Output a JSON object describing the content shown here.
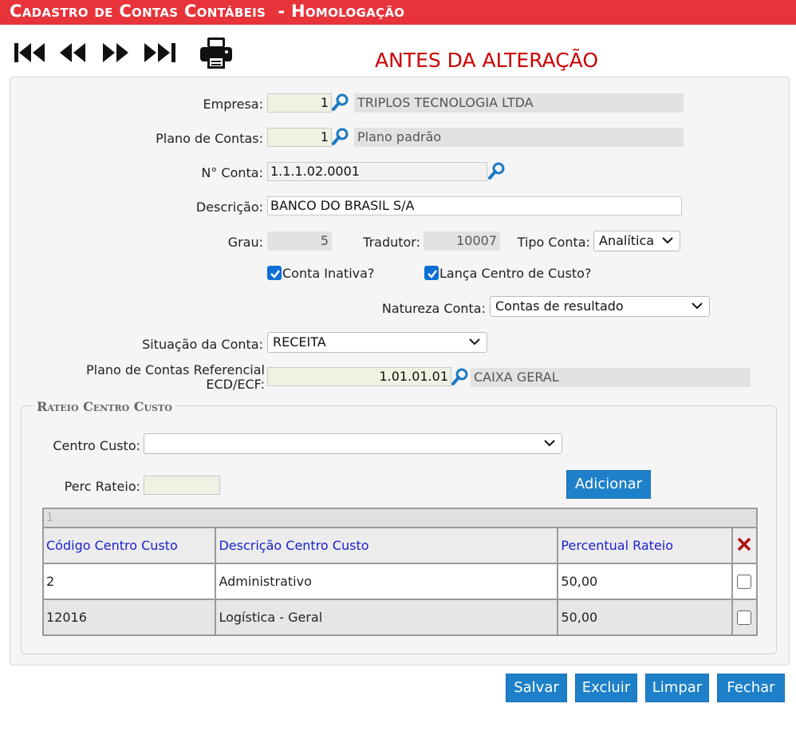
{
  "window": {
    "title": "Cadastro de Contas Contábeis  - Homologação"
  },
  "toolbar": {
    "icons": [
      "first-record-icon",
      "previous-record-icon",
      "next-record-icon",
      "last-record-icon",
      "printer-icon"
    ]
  },
  "warning": "ANTES DA ALTERAÇÃO",
  "form": {
    "empresa": {
      "label": "Empresa:",
      "code": "1",
      "name": "TRIPLOS TECNOLOGIA LTDA"
    },
    "plano": {
      "label": "Plano de Contas:",
      "code": "1",
      "name": "Plano padrão"
    },
    "conta": {
      "label": "N° Conta:",
      "value": "1.1.1.02.0001"
    },
    "descricao": {
      "label": "Descrição:",
      "value": "BANCO DO BRASIL S/A"
    },
    "grau": {
      "label": "Grau:",
      "value": "5"
    },
    "tradutor": {
      "label": "Tradutor:",
      "value": "10007"
    },
    "tipo_conta": {
      "label": "Tipo Conta:",
      "value": "Analítica"
    },
    "conta_inativa": {
      "label": "Conta Inativa?",
      "checked": true
    },
    "lanca_centro": {
      "label": "Lança Centro de Custo?",
      "checked": true
    },
    "natureza": {
      "label": "Natureza Conta:",
      "value": "Contas de resultado"
    },
    "situacao": {
      "label": "Situação da Conta:",
      "value": "RECEITA"
    },
    "referencial": {
      "label_line1": "Plano de Contas Referencial",
      "label_line2": "ECD/ECF:",
      "code": "1.01.01.01",
      "name": "CAIXA GERAL"
    }
  },
  "rateio": {
    "legend": "Rateio Centro Custo",
    "centro_label": "Centro Custo:",
    "centro_value": "",
    "perc_label": "Perc Rateio:",
    "perc_value": "",
    "add_button": "Adicionar",
    "grid": {
      "page": "1",
      "headers": [
        "Código Centro Custo",
        "Descrição Centro Custo",
        "Percentual Rateio"
      ],
      "rows": [
        {
          "codigo": "2",
          "descricao": "Administrativo",
          "percentual": "50,00",
          "selected": false
        },
        {
          "codigo": "12016",
          "descricao": "Logística - Geral",
          "percentual": "50,00",
          "selected": false
        }
      ]
    }
  },
  "actions": {
    "save": "Salvar",
    "delete": "Excluir",
    "clear": "Limpar",
    "close": "Fechar"
  },
  "colors": {
    "titlebar": "#e8333a",
    "warning": "#cc0000",
    "button": "#1e80c8",
    "header_text": "#1a22cc",
    "delete_x": "#b01010"
  }
}
